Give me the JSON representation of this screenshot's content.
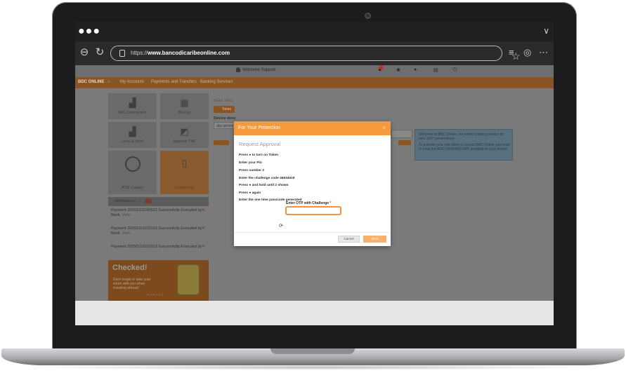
{
  "browser": {
    "url_prefix": "https://",
    "url_domain": "www.bancodicaribeonline.com"
  },
  "site": {
    "welcome": "Welcome Support",
    "brand": "BDC ONLINE",
    "menu": [
      "My Accounts",
      "Payments and Transfers",
      "Banking Services"
    ],
    "breadcrumb": "Home > Acc",
    "tiles": [
      "BdC Connection",
      "Bill Pay",
      "Local & Intrnl",
      "Approve TNF",
      "ATM Locator",
      "Contact Us"
    ],
    "token_label": "Token",
    "device_label": "Device desc",
    "device_value": "abs iphone",
    "notices": {
      "title": "Notifications",
      "items": [
        {
          "text": "Payment 20250116160522 Successfully Executed by Bank.",
          "link": "View"
        },
        {
          "text": "Payment 20250110102133 Successfully Executed by Bank.",
          "link": "View"
        },
        {
          "text": "Payment 20250110101813 Successfully Executed by",
          "link": ""
        }
      ]
    },
    "promo": {
      "title": "Checked!",
      "text": "Don't forget to take your token with you when traveling abroad"
    },
    "info": [
      "Welcome to BdC Online, our online banking service for your 24/7 convenience.",
      "To activate your soft token to access BdC Online you need to have the BDC DIGIPASS APP installed on your device."
    ]
  },
  "modal": {
    "title": "For Your Protection",
    "close": "×",
    "heading": "Request Approval",
    "steps": [
      "Press  ● to turn on Token",
      "Enter your Pin",
      "Press number 2",
      "Enter the challenge code 46634619",
      "Press  ● and hold until 2 shown",
      "Press  ● again",
      "Enter the one time passcode generated"
    ],
    "otp_label": "Enter OTP with Challenge",
    "otp_required": "*",
    "otp_value": "",
    "cancel": "Cancel",
    "next": "Next"
  }
}
